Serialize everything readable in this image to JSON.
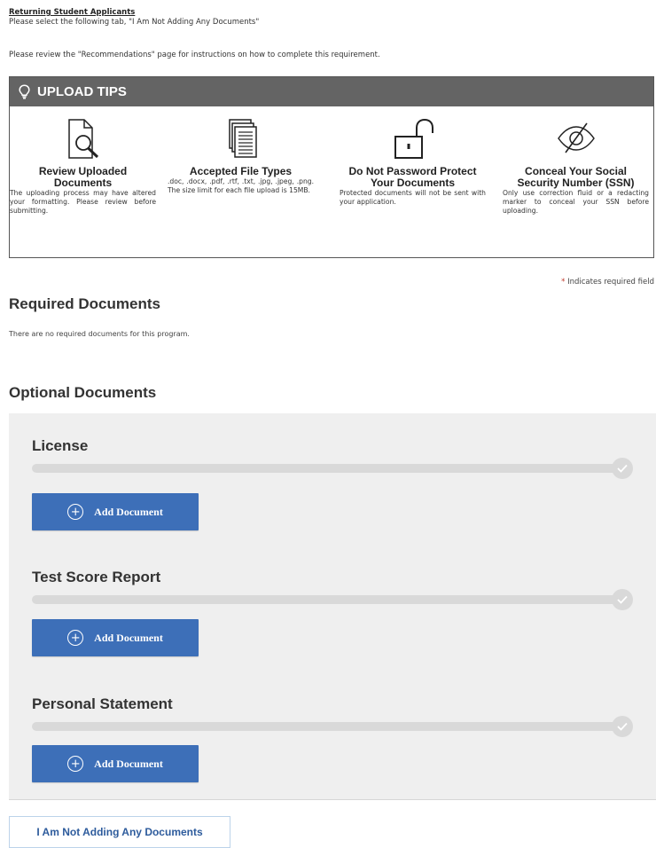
{
  "intro": {
    "heading": "Returning Student Applicants",
    "line": "Please select the following tab, \"I Am Not Adding Any Documents\"",
    "review": "Please review the \"Recommendations\" page for instructions on how to complete this requirement."
  },
  "upload_tips": {
    "title": "UPLOAD TIPS",
    "icon": "lightbulb-icon",
    "tips": [
      {
        "icon": "magnifier-document-icon",
        "title": "Review Uploaded Documents",
        "text": "The uploading process may have altered your formatting. Please review before submitting."
      },
      {
        "icon": "file-stack-icon",
        "title": "Accepted File Types",
        "text": ".doc, .docx, .pdf, .rtf, .txt, .jpg, .jpeg, .png. The size limit for each file upload is 15MB."
      },
      {
        "icon": "open-padlock-icon",
        "title": "Do Not Password Protect Your Documents",
        "text": "Protected documents will not be sent with your application."
      },
      {
        "icon": "eye-slash-icon",
        "title": "Conceal Your Social Security Number (SSN)",
        "text": "Only use correction fluid or a redacting marker to conceal your SSN before uploading."
      }
    ]
  },
  "required_note": {
    "star": "*",
    "text": " Indicates required field"
  },
  "required_section": {
    "title": "Required Documents",
    "empty_text": "There are no required documents for this program."
  },
  "optional_section": {
    "title": "Optional Documents",
    "documents": [
      {
        "name": "License",
        "button": "Add Document"
      },
      {
        "name": "Test Score Report",
        "button": "Add Document"
      },
      {
        "name": "Personal Statement",
        "button": "Add Document"
      }
    ]
  },
  "not_adding_button": "I Am Not Adding Any Documents",
  "colors": {
    "accent": "#3d6fb8",
    "tips_header": "#646464",
    "panel": "#efefef",
    "link": "#2d5b9c"
  }
}
